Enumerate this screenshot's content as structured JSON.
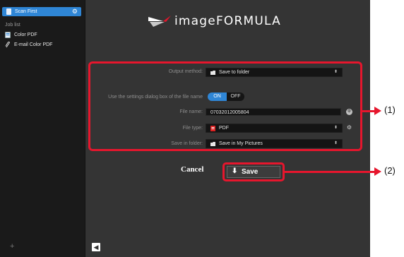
{
  "sidebar": {
    "top_item_label": "Scan First",
    "job_list_heading": "Job list",
    "items": [
      {
        "label": "Color PDF",
        "icon": "document-icon"
      },
      {
        "label": "E-mail Color PDF",
        "icon": "paperclip-icon"
      }
    ],
    "add_symbol": "+"
  },
  "header": {
    "logo_text": "imageFORMULA"
  },
  "form": {
    "output_method": {
      "label": "Output method:",
      "value": "Save to folder"
    },
    "use_settings": {
      "label": "Use the settings dialog box of the file name",
      "on_label": "ON",
      "off_label": "OFF",
      "state": "ON"
    },
    "file_name": {
      "label": "File name:",
      "value": "07032012005804"
    },
    "file_type": {
      "label": "File type:",
      "value": "PDF"
    },
    "save_in_folder": {
      "label": "Save in folder:",
      "value": "Save in My Pictures"
    }
  },
  "actions": {
    "cancel_label": "Cancel",
    "save_label": "Save"
  },
  "callouts": {
    "one": "(1)",
    "two": "(2)"
  },
  "colors": {
    "accent": "#2f86d6",
    "highlight": "#e6162d",
    "background": "#343434"
  }
}
